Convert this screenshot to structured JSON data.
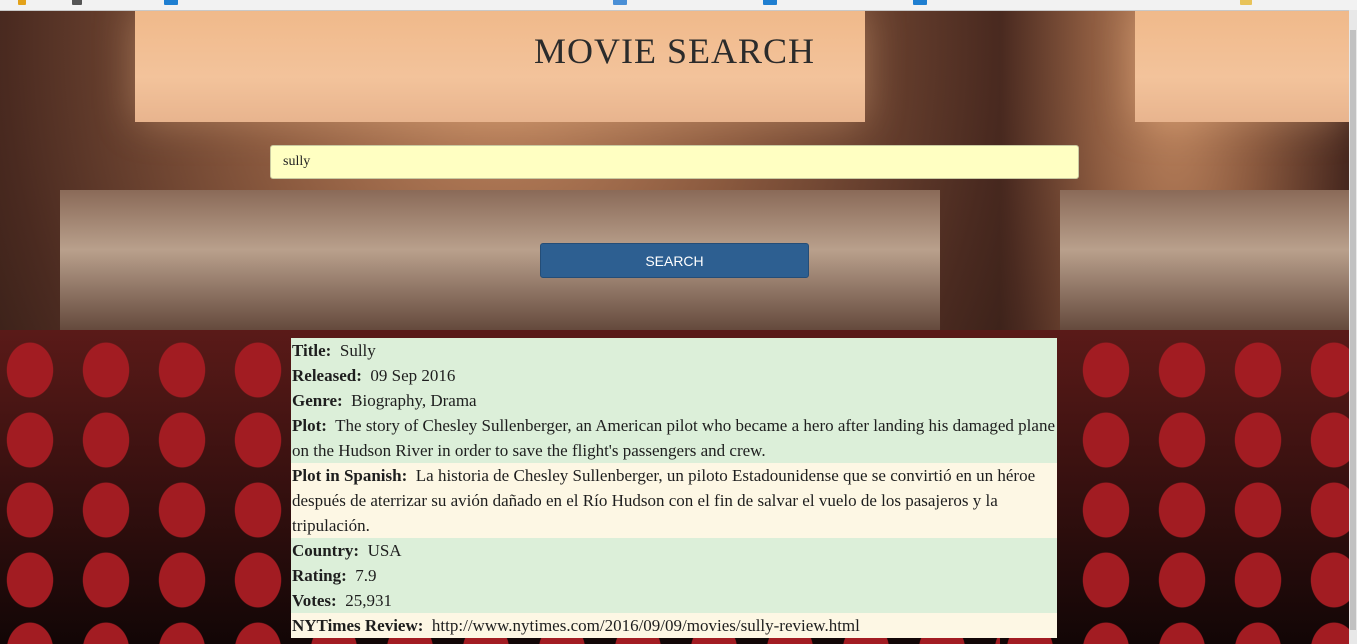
{
  "page": {
    "title": "MOVIE SEARCH"
  },
  "search": {
    "value": "sully",
    "button_label": "SEARCH"
  },
  "results": [
    {
      "label": "Title:",
      "value": "Sully",
      "bg": "green"
    },
    {
      "label": "Released:",
      "value": "09 Sep 2016",
      "bg": "green"
    },
    {
      "label": "Genre:",
      "value": "Biography, Drama",
      "bg": "green"
    },
    {
      "label": "Plot:",
      "value": "The story of Chesley Sullenberger, an American pilot who became a hero after landing his damaged plane on the Hudson River in order to save the flight's passengers and crew.",
      "bg": "green"
    },
    {
      "label": "Plot in Spanish:",
      "value": "La historia de Chesley Sullenberger, un piloto Estadounidense que se convirtió en un héroe después de aterrizar su avión dañado en el Río Hudson con el fin de salvar el vuelo de los pasajeros y la tripulación.",
      "bg": "cream"
    },
    {
      "label": "Country:",
      "value": "USA",
      "bg": "green"
    },
    {
      "label": "Rating:",
      "value": "7.9",
      "bg": "green"
    },
    {
      "label": "Votes:",
      "value": "25,931",
      "bg": "green"
    },
    {
      "label": "NYTimes Review:",
      "value": "http://www.nytimes.com/2016/09/09/movies/sully-review.html",
      "bg": "cream"
    }
  ],
  "colors": {
    "input_bg": "#ffffc2",
    "button_bg": "#2d5f91",
    "row_green": "#dcefd9",
    "row_cream": "#fdf7e4"
  }
}
